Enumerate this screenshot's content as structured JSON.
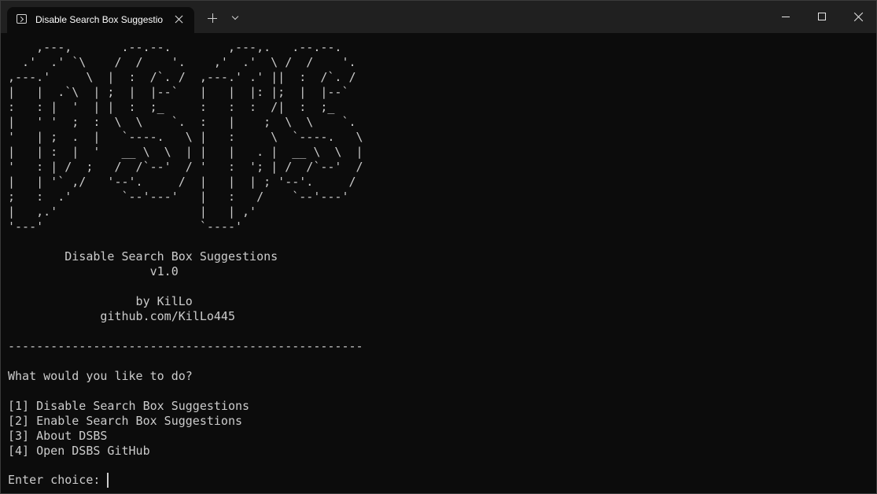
{
  "window": {
    "tab_title": "Disable Search Box Suggestio",
    "tab_icon": "terminal-icon"
  },
  "terminal": {
    "ascii_art": "    ,---,       .--.--.        ,---,.   .--.--.\n  .'  .' `\\    /  /    '.    ,'  .'  \\ /  /    '.\n,---.'     \\  |  :  /`. /  ,---.' .' ||  :  /`. /\n|   |  .`\\  | ;  |  |--`   |   |  |: |;  |  |--`\n:   : |  '  | |  :  ;_     :   :  :  /|  :  ;_\n|   ' '  ;  :  \\  \\    `.  :   |    ;  \\  \\    `.\n'   | ;  .  |   `----.   \\ |   :     \\  `----.   \\\n|   | :  |  '   __ \\  \\  | |   |   . |  __ \\  \\  |\n'   : | /  ;   /  /`--'  / '   :  '; | /  /`--'  /\n|   | '` ,/   '--'.     /  |   |  | ; '--'.     /\n;   :  .'       `--'---'   |   :   /    `--'---'\n|   ,.'                    |   | ,'\n'---'                      `----'",
    "title_line": "        Disable Search Box Suggestions",
    "version_line": "                    v1.0",
    "author_line": "                  by KilLo",
    "github_line": "             github.com/KilLo445",
    "separator": "--------------------------------------------------",
    "question": "What would you like to do?",
    "options": [
      "[1] Disable Search Box Suggestions",
      "[2] Enable Search Box Suggestions",
      "[3] About DSBS",
      "[4] Open DSBS GitHub"
    ],
    "prompt": "Enter choice: "
  }
}
